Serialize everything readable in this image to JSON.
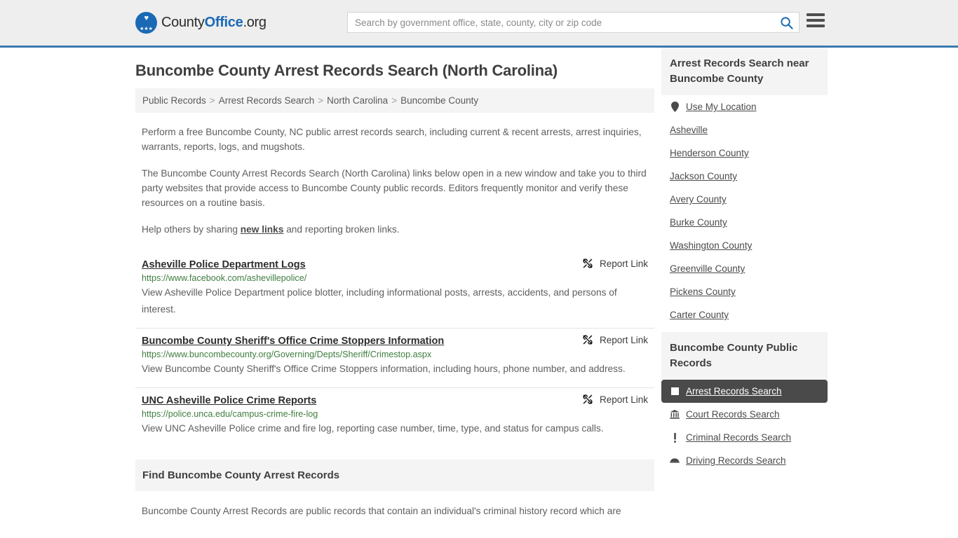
{
  "header": {
    "logo": {
      "part1": "County",
      "part2": "Office",
      "part3": ".org",
      "eagle_glyph": "♥",
      "stars_glyph": "★★★"
    },
    "search_placeholder": "Search by government office, state, county, city or zip code",
    "search_value": "",
    "search_icon": "search-icon",
    "menu_icon": "hamburger-menu-icon"
  },
  "page": {
    "title": "Buncombe County Arrest Records Search (North Carolina)"
  },
  "breadcrumb": {
    "items": [
      {
        "label": "Public Records"
      },
      {
        "label": "Arrest Records Search"
      },
      {
        "label": "North Carolina"
      },
      {
        "label": "Buncombe County"
      }
    ],
    "separator": ">"
  },
  "intro": {
    "p1": "Perform a free Buncombe County, NC public arrest records search, including current & recent arrests, arrest inquiries, warrants, reports, logs, and mugshots.",
    "p2": "The Buncombe County Arrest Records Search (North Carolina) links below open in a new window and take you to third party websites that provide access to Buncombe County public records. Editors frequently monitor and verify these resources on a routine basis.",
    "p3_before": "Help others by sharing ",
    "p3_link": "new links",
    "p3_after": " and reporting broken links."
  },
  "report_link_label": "Report Link",
  "results": [
    {
      "title": "Asheville Police Department Logs",
      "url": "https://www.facebook.com/ashevillepolice/",
      "description": "View Asheville Police Department police blotter, including informational posts, arrests, accidents, and persons of interest."
    },
    {
      "title": "Buncombe County Sheriff's Office Crime Stoppers Information",
      "url": "https://www.buncombecounty.org/Governing/Depts/Sheriff/Crimestop.aspx",
      "description": "View Buncombe County Sheriff's Office Crime Stoppers information, including hours, phone number, and address."
    },
    {
      "title": "UNC Asheville Police Crime Reports",
      "url": "https://police.unca.edu/campus-crime-fire-log",
      "description": "View UNC Asheville Police crime and fire log, reporting case number, time, type, and status for campus calls."
    }
  ],
  "find_section": {
    "heading": "Find Buncombe County Arrest Records",
    "paragraph": "Buncombe County Arrest Records are public records that contain an individual's criminal history record which are"
  },
  "sidebar": {
    "near_box": {
      "heading": "Arrest Records Search near Buncombe County",
      "items": [
        {
          "label": "Use My Location",
          "icon": "map-pin-icon",
          "glyph": "•"
        },
        {
          "label": "Asheville",
          "icon": "",
          "glyph": ""
        },
        {
          "label": "Henderson County",
          "icon": "",
          "glyph": ""
        },
        {
          "label": "Jackson County",
          "icon": "",
          "glyph": ""
        },
        {
          "label": "Avery County",
          "icon": "",
          "glyph": ""
        },
        {
          "label": "Burke County",
          "icon": "",
          "glyph": ""
        },
        {
          "label": "Washington County",
          "icon": "",
          "glyph": ""
        },
        {
          "label": "Greenville County",
          "icon": "",
          "glyph": ""
        },
        {
          "label": "Pickens County",
          "icon": "",
          "glyph": ""
        },
        {
          "label": "Carter County",
          "icon": "",
          "glyph": ""
        }
      ]
    },
    "public_records_box": {
      "heading": "Buncombe County Public Records",
      "items": [
        {
          "label": "Arrest Records Search",
          "icon": "white-square-icon",
          "glyph": "",
          "active": true
        },
        {
          "label": "Court Records Search",
          "icon": "bank-building-icon",
          "glyph": "🏛",
          "active": false
        },
        {
          "label": "Criminal Records Search",
          "icon": "exclamation-icon",
          "glyph": "!",
          "active": false
        },
        {
          "label": "Driving Records Search",
          "icon": "car-icon",
          "glyph": "🚗",
          "active": false
        }
      ]
    }
  },
  "colors": {
    "brand_blue": "#1a69b5",
    "header_rule": "#3a7ab0",
    "url_green": "#3f7d3f",
    "active_bg": "#4a4a4a",
    "panel_gray": "#f4f4f4"
  }
}
